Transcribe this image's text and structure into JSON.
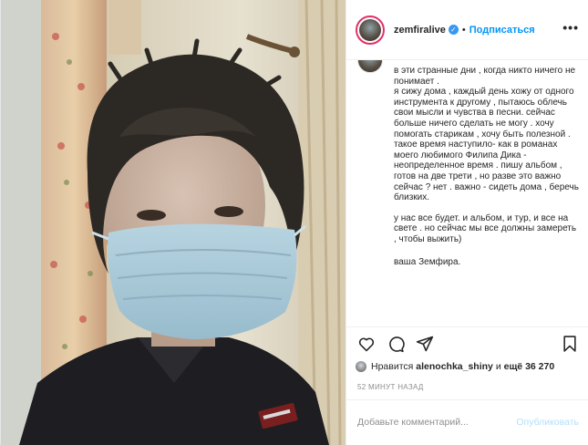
{
  "header": {
    "username": "zemfiralive",
    "verified_mark": "✓",
    "separator": "•",
    "follow_label": "Подписаться",
    "more_label": "•••"
  },
  "caption": {
    "lines": [
      "в эти странные дни , когда никто ничего не понимает .",
      "я сижу дома , каждый день хожу от одного инструмента к другому , пытаюсь облечь свои мысли и чувства в песни. сейчас больше ничего сделать не могу . хочу помогать старикам , хочу быть полезной . такое время наступило- как в романах моего любимого Филипа Дика - неопределенное время . пишу альбом , готов на две трети , но разве это важно сейчас ? нет . важно - сидеть дома , беречь близких.",
      "у нас все будет. и альбом, и тур, и все на свете . но сейчас мы все должны замереть , чтобы выжить)",
      "ваша Земфира."
    ]
  },
  "actions": {
    "like_icon": "heart-icon",
    "comment_icon": "comment-icon",
    "share_icon": "paper-plane-icon",
    "save_icon": "bookmark-icon"
  },
  "likes": {
    "prefix": "Нравится",
    "user": "alenochka_shiny",
    "middle": "и",
    "others": "ещё 36 270"
  },
  "time": "52 МИНУТ НАЗАД",
  "comment": {
    "placeholder": "Добавьте комментарий...",
    "publish_label": "Опубликовать"
  },
  "colors": {
    "accent": "#0095f6",
    "publish_disabled": "#b2dffc",
    "mask": "#a9c9d8"
  }
}
